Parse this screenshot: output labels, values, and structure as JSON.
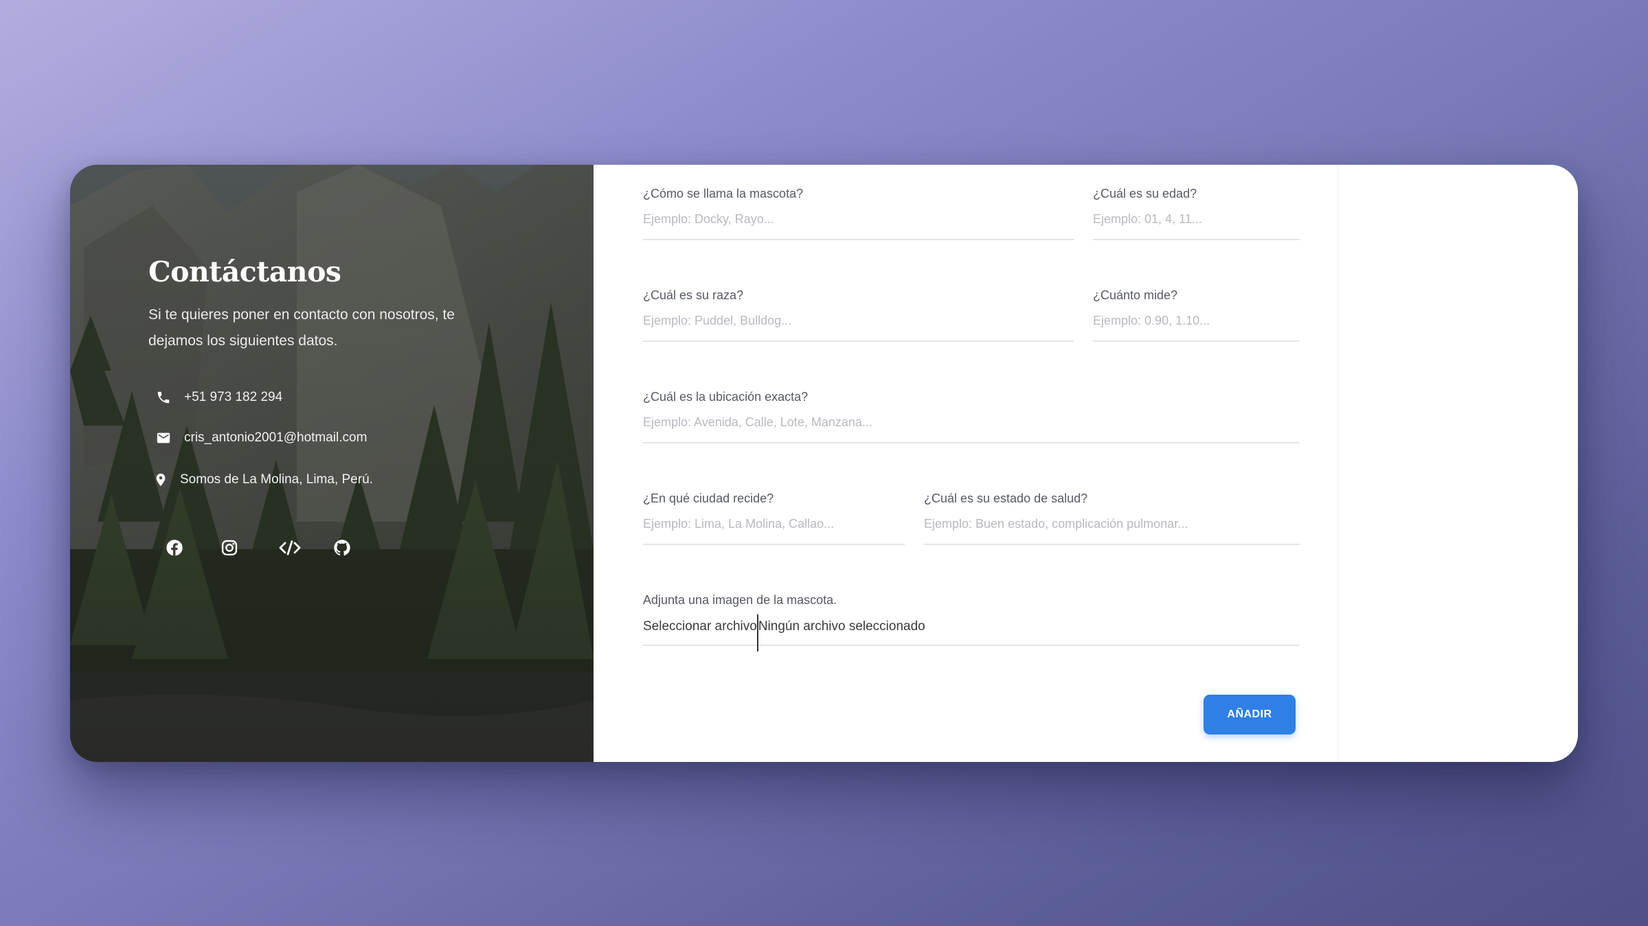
{
  "contact": {
    "title": "Contáctanos",
    "description": "Si te quieres poner en contacto con nosotros, te dejamos los siguientes datos.",
    "phone": "+51 973 182 294",
    "email": "cris_antonio2001@hotmail.com",
    "location": "Somos de La Molina, Lima, Perú.",
    "social_icons": [
      "facebook-icon",
      "instagram-icon",
      "code-icon",
      "github-icon"
    ]
  },
  "form": {
    "name": {
      "label": "¿Cómo se llama la mascota?",
      "placeholder": "Ejemplo: Docky, Rayo...",
      "value": ""
    },
    "age": {
      "label": "¿Cuál es su edad?",
      "placeholder": "Ejemplo: 01, 4, 11...",
      "value": ""
    },
    "breed": {
      "label": "¿Cuál es su raza?",
      "placeholder": "Ejemplo: Puddel, Bulldog...",
      "value": ""
    },
    "height": {
      "label": "¿Cuánto mide?",
      "placeholder": "Ejemplo: 0.90, 1.10...",
      "value": ""
    },
    "location": {
      "label": "¿Cuál es la ubicación exacta?",
      "placeholder": "Ejemplo: Avenida, Calle, Lote, Manzana...",
      "value": ""
    },
    "city": {
      "label": "¿En qué ciudad recide?",
      "placeholder": "Ejemplo: Lima, La Molina, Callao...",
      "value": ""
    },
    "health": {
      "label": "¿Cuál es su estado de salud?",
      "placeholder": "Ejemplo: Buen estado, complicación pulmonar...",
      "value": ""
    },
    "image": {
      "label": "Adjunta una imagen de la mascota.",
      "button": "Seleccionar archivo",
      "status": "Ningún archivo seleccionado"
    },
    "submit_label": "AÑADIR"
  },
  "colors": {
    "accent": "#2f7fe6",
    "background": "#8e8ccc",
    "panel_overlay": "#3a3e34"
  }
}
